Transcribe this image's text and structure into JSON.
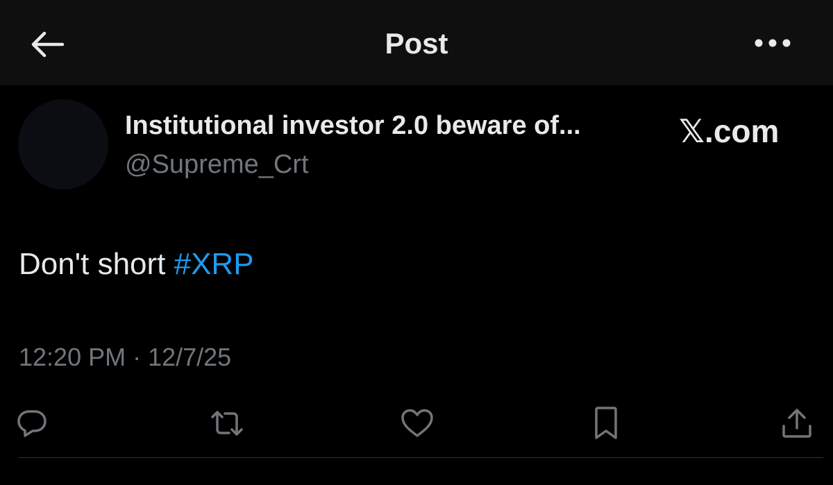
{
  "header": {
    "title": "Post",
    "back_icon": "arrow-left-icon",
    "more_icon": "ellipsis-icon"
  },
  "author": {
    "display_name": "Institutional investor 2.0 beware of...",
    "handle": "@Supreme_Crt"
  },
  "watermark": "𝕏.com",
  "post": {
    "text_prefix": "Don't short ",
    "hashtag": "#XRP",
    "time": "12:20 PM",
    "separator": " · ",
    "date": "12/7/25"
  },
  "actions": [
    {
      "name": "reply",
      "icon": "comment-icon"
    },
    {
      "name": "repost",
      "icon": "repost-icon"
    },
    {
      "name": "like",
      "icon": "heart-icon"
    },
    {
      "name": "bookmark",
      "icon": "bookmark-icon"
    },
    {
      "name": "share",
      "icon": "share-icon"
    }
  ],
  "colors": {
    "background": "#000000",
    "header_background": "#0f0f0f",
    "primary_text": "#e7e9ea",
    "secondary_text": "#71767b",
    "accent": "#1d9bf0",
    "divider": "#2f3336"
  }
}
